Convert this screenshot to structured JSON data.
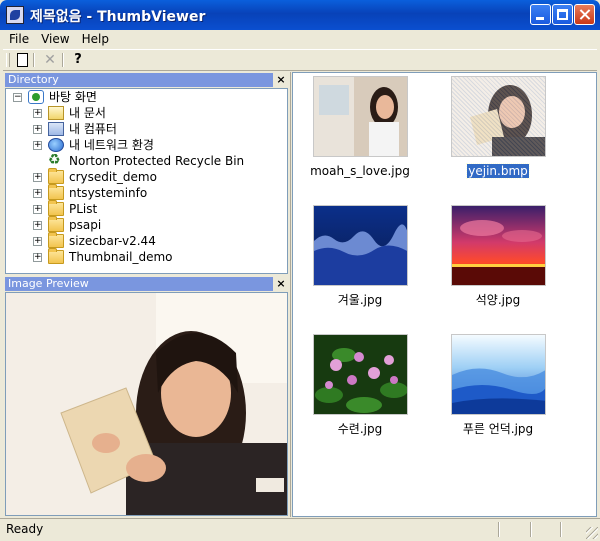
{
  "window": {
    "title": "제목없음 - ThumbViewer"
  },
  "menu": [
    "File",
    "View",
    "Help"
  ],
  "directory_panel": {
    "title": "Directory",
    "tree": [
      {
        "label": "바탕 화면",
        "icon": "desktop-icon",
        "expander": "−"
      },
      {
        "label": "내 문서",
        "icon": "my-documents-icon",
        "expander": "+"
      },
      {
        "label": "내 컴퓨터",
        "icon": "my-computer-icon",
        "expander": "+"
      },
      {
        "label": "내 네트워크 환경",
        "icon": "network-icon",
        "expander": "+"
      },
      {
        "label": "Norton Protected Recycle Bin",
        "icon": "recycle-bin-icon",
        "expander": ""
      },
      {
        "label": "crysedit_demo",
        "icon": "folder-icon",
        "expander": "+"
      },
      {
        "label": "ntsysteminfo",
        "icon": "folder-icon",
        "expander": "+"
      },
      {
        "label": "PList",
        "icon": "folder-icon",
        "expander": "+"
      },
      {
        "label": "psapi",
        "icon": "folder-icon",
        "expander": "+"
      },
      {
        "label": "sizecbar-v2.44",
        "icon": "folder-icon",
        "expander": "+"
      },
      {
        "label": "Thumbnail_demo",
        "icon": "folder-icon",
        "expander": "+"
      }
    ]
  },
  "preview_panel": {
    "title": "Image Preview"
  },
  "thumbnails": [
    {
      "label": "moah_s_love.jpg",
      "selected": false
    },
    {
      "label": "yejin.bmp",
      "selected": true
    },
    {
      "label": "겨울.jpg",
      "selected": false
    },
    {
      "label": "석양.jpg",
      "selected": false
    },
    {
      "label": "수련.jpg",
      "selected": false
    },
    {
      "label": "푸른 언덕.jpg",
      "selected": false
    }
  ],
  "status": {
    "text": "Ready"
  },
  "colors": {
    "titlebar": "#0842b8",
    "panel_title": "#7a96df",
    "selection": "#316ac5"
  }
}
